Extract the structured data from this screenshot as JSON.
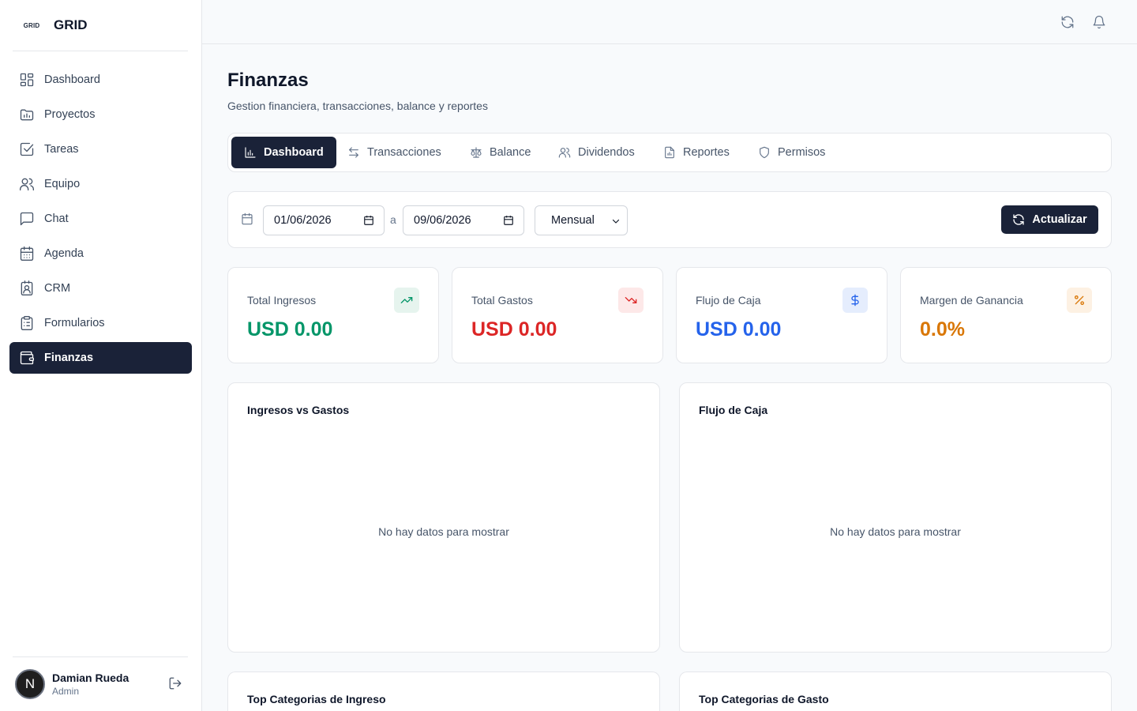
{
  "brand": {
    "logo_text": "GRID",
    "name": "GRID"
  },
  "sidebar": {
    "items": [
      {
        "label": "Dashboard",
        "icon": "dashboard-icon"
      },
      {
        "label": "Proyectos",
        "icon": "folder-icon"
      },
      {
        "label": "Tareas",
        "icon": "check-square-icon"
      },
      {
        "label": "Equipo",
        "icon": "users-icon"
      },
      {
        "label": "Chat",
        "icon": "message-square-icon"
      },
      {
        "label": "Agenda",
        "icon": "calendar-icon"
      },
      {
        "label": "CRM",
        "icon": "contact-icon"
      },
      {
        "label": "Formularios",
        "icon": "clipboard-icon"
      },
      {
        "label": "Finanzas",
        "icon": "wallet-icon",
        "active": true
      }
    ]
  },
  "user": {
    "initial": "N",
    "name": "Damian Rueda",
    "role": "Admin"
  },
  "page": {
    "title": "Finanzas",
    "subtitle": "Gestion financiera, transacciones, balance y reportes"
  },
  "tabs": [
    {
      "label": "Dashboard",
      "icon": "bar-chart-icon",
      "active": true
    },
    {
      "label": "Transacciones",
      "icon": "arrows-left-right-icon"
    },
    {
      "label": "Balance",
      "icon": "scale-icon"
    },
    {
      "label": "Dividendos",
      "icon": "users-icon"
    },
    {
      "label": "Reportes",
      "icon": "file-chart-icon"
    },
    {
      "label": "Permisos",
      "icon": "shield-icon"
    }
  ],
  "filters": {
    "date_from": "01/06/2026",
    "separator": "a",
    "date_to": "09/06/2026",
    "period": "Mensual",
    "refresh_label": "Actualizar"
  },
  "kpis": [
    {
      "label": "Total Ingresos",
      "value": "USD 0.00",
      "color": "#059669",
      "badge_bg": "#e6f4ee",
      "icon": "trending-up-icon"
    },
    {
      "label": "Total Gastos",
      "value": "USD 0.00",
      "color": "#dc2626",
      "badge_bg": "#fde8e8",
      "icon": "trending-down-icon"
    },
    {
      "label": "Flujo de Caja",
      "value": "USD 0.00",
      "color": "#2563eb",
      "badge_bg": "#e5edfd",
      "icon": "dollar-icon"
    },
    {
      "label": "Margen de Ganancia",
      "value": "0.0%",
      "color": "#d97706",
      "badge_bg": "#fdf1e3",
      "icon": "percent-icon"
    }
  ],
  "panels": {
    "income_vs_expense": {
      "title": "Ingresos vs Gastos",
      "empty": "No hay datos para mostrar"
    },
    "cash_flow": {
      "title": "Flujo de Caja",
      "empty": "No hay datos para mostrar"
    },
    "top_income": {
      "title": "Top Categorias de Ingreso"
    },
    "top_expense": {
      "title": "Top Categorias de Gasto"
    }
  }
}
